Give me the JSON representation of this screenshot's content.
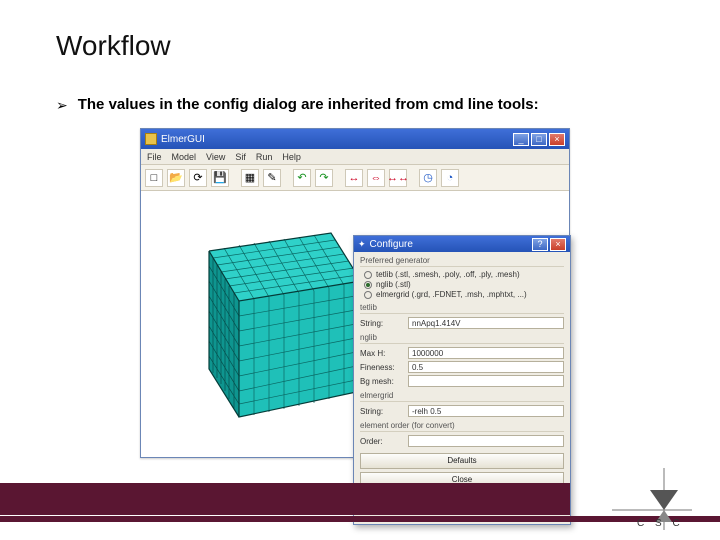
{
  "slide": {
    "title": "Workflow",
    "bullet": "The values in the config dialog are inherited from cmd line tools:"
  },
  "app": {
    "title": "ElmerGUI",
    "menus": [
      "File",
      "Model",
      "View",
      "Sif",
      "Run",
      "Help"
    ],
    "win_min": "_",
    "win_max": "□",
    "win_close": "×"
  },
  "cfg": {
    "title": "Configure",
    "help": "?",
    "close": "×",
    "group_generator": "Preferred generator",
    "radio1": "tetlib (.stl, .smesh, .poly, .off, .ply, .mesh)",
    "radio2": "nglib (.stl)",
    "radio3": "elmergrid (.grd, .FDNET, .msh, .mphtxt, ...)",
    "group_tetlib": "tetlib",
    "tet_string_lbl": "String:",
    "tet_string_val": "nnApq1.414V",
    "group_nglib": "nglib",
    "ng_maxh_lbl": "Max H:",
    "ng_maxh_val": "1000000",
    "ng_fine_lbl": "Fineness:",
    "ng_fine_val": "0.5",
    "ng_bg_lbl": "Bg mesh:",
    "ng_bg_val": "",
    "group_elmer": "elmergrid",
    "eg_string_lbl": "String:",
    "eg_string_val": "-relh 0.5",
    "group_convert": "element order (for convert)",
    "order_lbl": "Order:",
    "order_val": "",
    "btn_defaults": "Defaults",
    "btn_close": "Close"
  },
  "logo": {
    "text": "C S C"
  }
}
